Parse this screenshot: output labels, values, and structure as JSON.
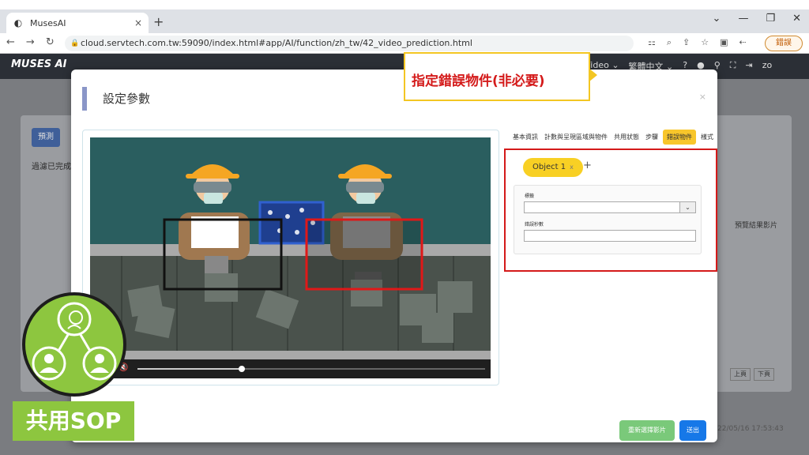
{
  "browser": {
    "tab_title": "MusesAI",
    "tab_close": "×",
    "new_tab": "+",
    "url": "cloud.servtech.com.tw:59090/index.html#app/AI/function/zh_tw/42_video_prediction.html",
    "error_label": "錯誤",
    "window_buttons": [
      "⌄",
      "—",
      "❐",
      "✕"
    ],
    "nav": [
      "←",
      "→",
      "↻"
    ],
    "tools": [
      "⚏",
      "⌕",
      "⇪",
      "☆",
      "▣",
      "⇠"
    ]
  },
  "app_header": {
    "logo": "MUSES AI",
    "items": [
      "Video ⌄",
      "繁體中文 ⌄",
      "?",
      "●",
      "⚲",
      "⛶",
      "⇥",
      "zo"
    ]
  },
  "background": {
    "button": "預測",
    "text": "過濾已完成",
    "column_label": "預覽結果影片",
    "pager": [
      "上頁",
      "下頁"
    ],
    "timestamp": "22/05/16 17:53:43"
  },
  "modal": {
    "title": "設定參數",
    "close": "×",
    "tabs": [
      "基本資訊",
      "計數與呈現區域與物件",
      "共用狀態",
      "步驟",
      "錯誤物件",
      "樣式"
    ],
    "active_tab": "錯誤物件",
    "object_tag": "Object 1",
    "object_tag_close": "x",
    "add_object": "+",
    "field1_label": "標籤",
    "field2_label": "錯誤秒數",
    "select_arrow": "⌄",
    "reselect_button": "重新選擇影片",
    "submit_button": "送出"
  },
  "video": {
    "volume_icon": "🔇",
    "progress": 0.3
  },
  "callout": {
    "text": "指定錯誤物件(非必要)"
  },
  "sop": {
    "label": "共用SOP"
  },
  "colors": {
    "accent_yellow": "#f8c62b",
    "highlight_red": "#d41a1a",
    "sop_green": "#8dc63f",
    "submit_blue": "#1678e8"
  }
}
